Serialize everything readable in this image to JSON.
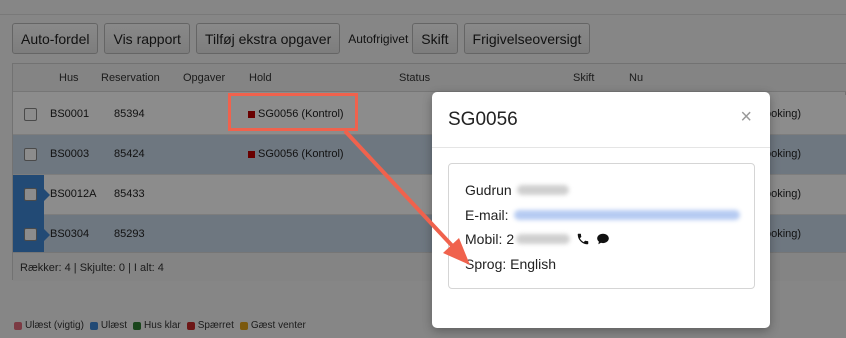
{
  "toolbar": {
    "auto_fordel": "Auto-fordel",
    "vis_rapport": "Vis rapport",
    "tilfoej": "Tilføj ekstra opgaver",
    "autofrigivet": "Autofrigivet",
    "skift": "Skift",
    "frigivelse": "Frigivelseoversigt"
  },
  "grid": {
    "columns": {
      "hus": "Hus",
      "reservation": "Reservation",
      "opgaver": "Opgaver",
      "hold": "Hold",
      "status": "Status",
      "skift": "Skift",
      "nu": "Nu"
    },
    "rows": [
      {
        "hus": "BS0001",
        "reservation": "85394",
        "hold": "SG0056 (Kontrol)",
        "tail": "ooking)"
      },
      {
        "hus": "BS0003",
        "reservation": "85424",
        "hold": "SG0056 (Kontrol)",
        "tail": "ooking)"
      },
      {
        "hus": "BS0012A",
        "reservation": "85433",
        "hold": "",
        "tail": "ooking)"
      },
      {
        "hus": "BS0304",
        "reservation": "85293",
        "hold": "",
        "tail": "ooking)"
      }
    ],
    "footer": "Rækker: 4 | Skjulte: 0 | I alt: 4"
  },
  "legend": [
    {
      "label": "Ulæst (vigtig)",
      "color": "#e06a7a"
    },
    {
      "label": "Ulæst",
      "color": "#3f87d6"
    },
    {
      "label": "Hus klar",
      "color": "#2e7d32"
    },
    {
      "label": "Spærret",
      "color": "#c62828"
    },
    {
      "label": "Gæst venter",
      "color": "#e0a21a"
    }
  ],
  "modal": {
    "title": "SG0056",
    "close": "×",
    "name_label": "Gudrun",
    "email_label": "E-mail:",
    "mobil_label": "Mobil:",
    "mobil_prefix": "2",
    "sprog": "Sprog: English"
  },
  "colors": {
    "annotation": "#f0624d",
    "hold_marker": "#c00000",
    "selected_row": "#c9d9ea"
  }
}
